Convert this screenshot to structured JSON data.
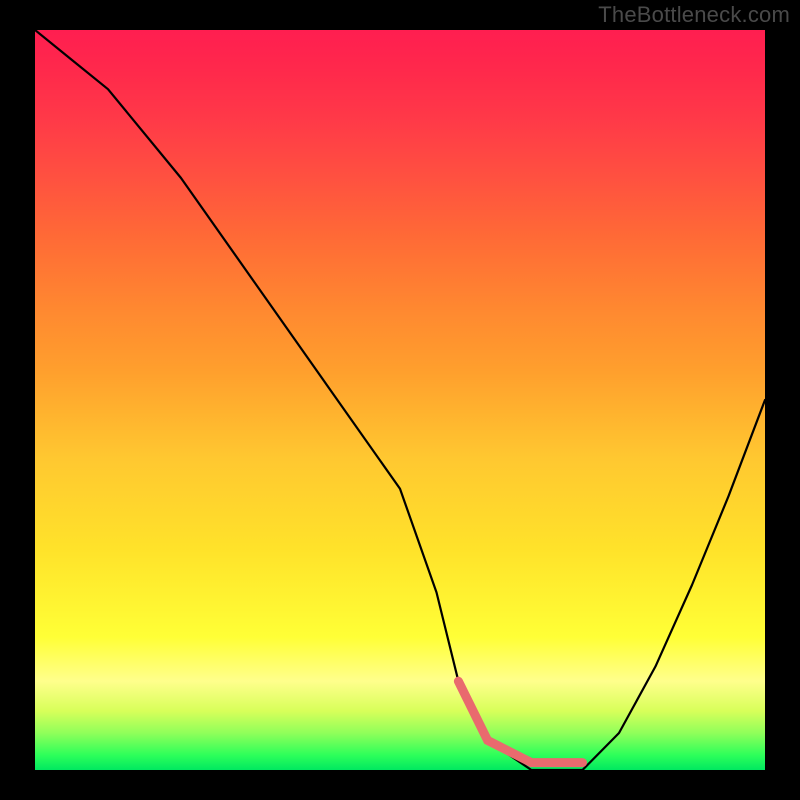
{
  "watermark": "TheBottleneck.com",
  "chart_data": {
    "type": "line",
    "title": "",
    "xlabel": "",
    "ylabel": "",
    "xlim": [
      0,
      100
    ],
    "ylim": [
      0,
      100
    ],
    "series": [
      {
        "name": "bottleneck-curve",
        "x": [
          0,
          5,
          10,
          20,
          30,
          40,
          50,
          55,
          58,
          62,
          68,
          72,
          75,
          80,
          85,
          90,
          95,
          100
        ],
        "values": [
          100,
          96,
          92,
          80,
          66,
          52,
          38,
          24,
          12,
          4,
          0,
          0,
          0,
          5,
          14,
          25,
          37,
          50
        ]
      }
    ],
    "annotations": [
      {
        "name": "trough-highlight",
        "x_start": 57,
        "x_end": 75,
        "y": 1,
        "color": "#e96a6e"
      }
    ],
    "background_gradient": {
      "stops": [
        {
          "pos": 0,
          "color": "#ff1e50"
        },
        {
          "pos": 20,
          "color": "#ff5140"
        },
        {
          "pos": 46,
          "color": "#ff9f2d"
        },
        {
          "pos": 70,
          "color": "#ffe22a"
        },
        {
          "pos": 88,
          "color": "#ffff8c"
        },
        {
          "pos": 100,
          "color": "#00e860"
        }
      ]
    }
  }
}
